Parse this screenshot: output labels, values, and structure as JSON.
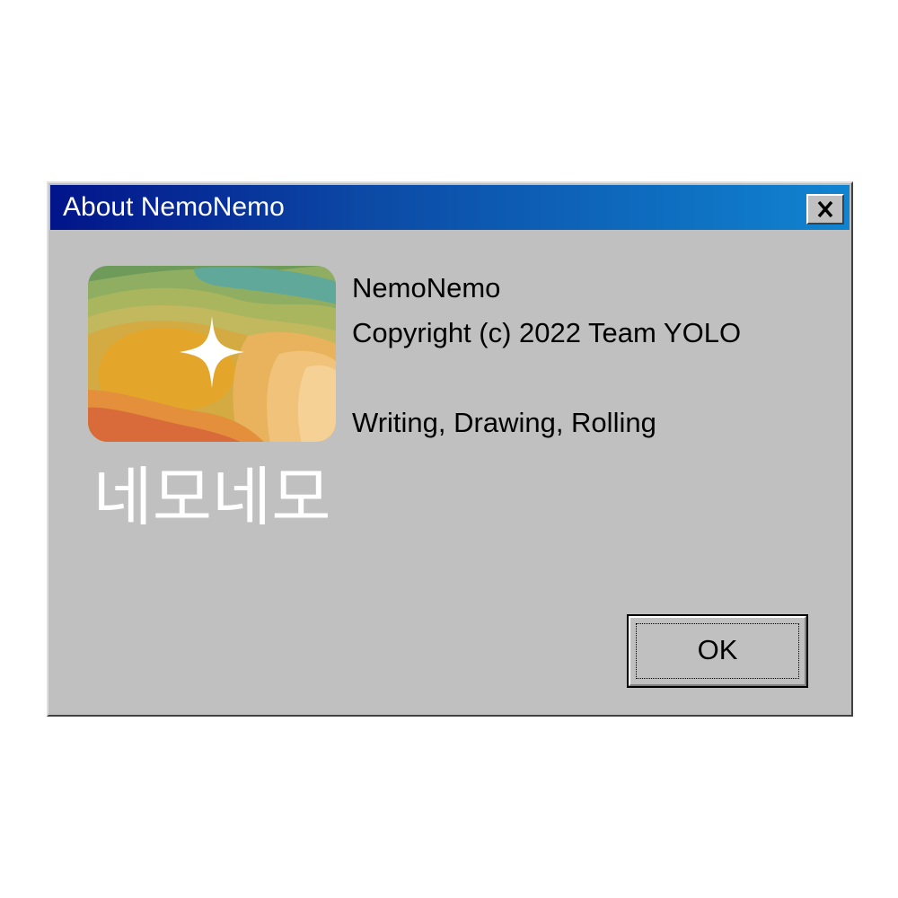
{
  "window": {
    "title": "About NemoNemo",
    "close_icon": "close-x-icon",
    "colors": {
      "titlebar_start": "#02148a",
      "titlebar_end": "#1084d0",
      "face": "#c0c0c0"
    }
  },
  "logo": {
    "icon": "sparkle-icon",
    "wordmark": "네모네모"
  },
  "info": {
    "app_name": "NemoNemo",
    "copyright": "Copyright (c) 2022 Team YOLO",
    "tagline": "Writing, Drawing, Rolling"
  },
  "buttons": {
    "ok_label": "OK"
  }
}
